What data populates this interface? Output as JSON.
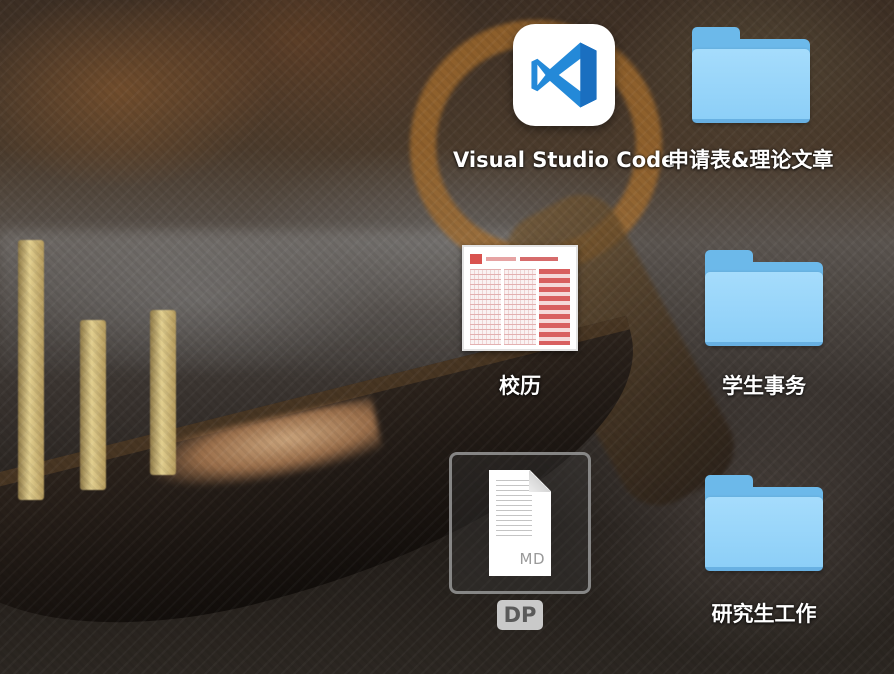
{
  "desktop": {
    "items": [
      {
        "label": "Visual Studio Code",
        "icon": "vscode-icon",
        "type": "application"
      },
      {
        "label": "申请表&理论文章",
        "icon": "folder-icon",
        "type": "folder"
      },
      {
        "label": "校历",
        "icon": "calendar-thumbnail-icon",
        "type": "document"
      },
      {
        "label": "学生事务",
        "icon": "folder-icon",
        "type": "folder"
      },
      {
        "label": "DP",
        "icon": "markdown-file-icon",
        "type": "file",
        "extension_badge": "MD",
        "selected": true
      },
      {
        "label": "研究生工作",
        "icon": "folder-icon",
        "type": "folder"
      }
    ]
  },
  "colors": {
    "folder_blue": "#8bcef7",
    "vscode_blue": "#1f8fe0",
    "selection_label_bg": "#c9c9c9"
  }
}
